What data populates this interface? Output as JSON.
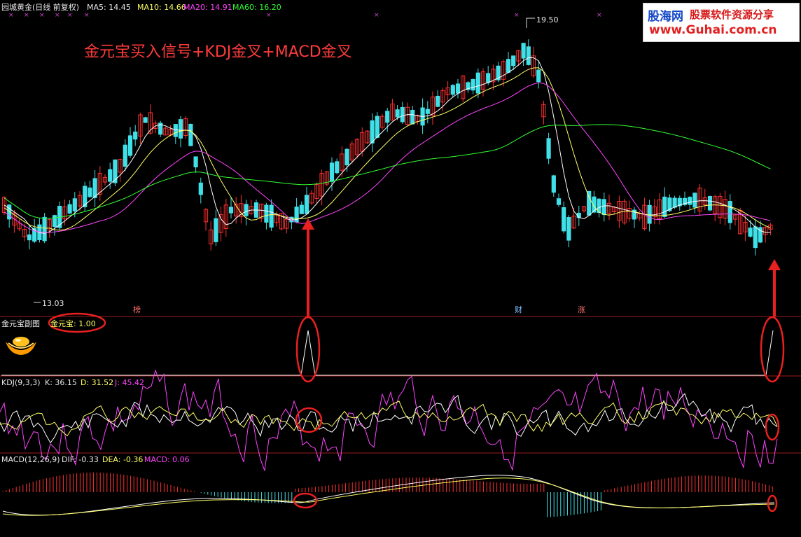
{
  "header": {
    "symbol_label": "园城黄金(日线 前复权)",
    "ma5_label": "MA5: 14.45",
    "ma10_label": "MA10: 14.66",
    "ma20_label": "MA20: 14.91",
    "ma60_label": "MA60: 16.20"
  },
  "title_overlay": "金元宝买入信号+KDJ金叉+MACD金叉",
  "logo": {
    "brand": "股海网",
    "tagline": "股票软件资源分享",
    "url": "www.Guhai.com.cn"
  },
  "price_labels": {
    "high": "19.50",
    "low": "13.03"
  },
  "event_badges": [
    {
      "text": "榜",
      "color": "#ff7070"
    },
    {
      "text": "财",
      "color": "#80c0ff"
    },
    {
      "text": "涨",
      "color": "#ff7070"
    }
  ],
  "sub_indicator": {
    "name": "金元宝副图",
    "value_label": "金元宝: 1.00"
  },
  "kdj": {
    "name": "KDJ(9,3,3)",
    "k_label": "K: 36.15",
    "d_label": "D: 31.52",
    "j_label": "J: 45.42"
  },
  "macd": {
    "name": "MACD(12,26,9)",
    "dif_label": "DIF: -0.33",
    "dea_label": "DEA: -0.36",
    "macd_label": "MACD: 0.06"
  },
  "colors": {
    "up": "#ff3030",
    "down": "#40e0e8",
    "ma5": "#ffffff",
    "ma10": "#ffff66",
    "ma20": "#ff44ff",
    "ma60": "#33ff33",
    "annotation": "#e82020",
    "panel_border": "#9c1c1c"
  }
}
